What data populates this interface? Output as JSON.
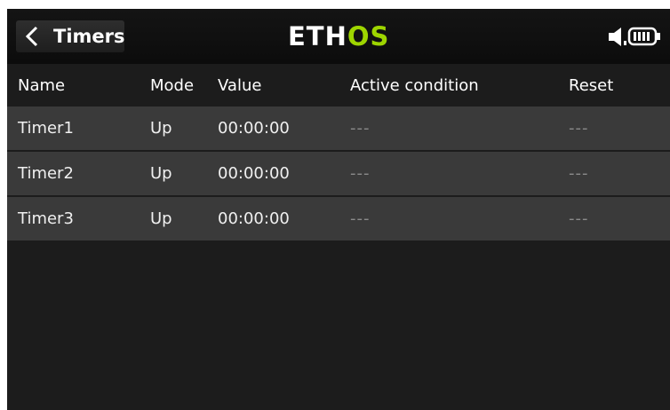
{
  "header": {
    "back_title": "Timers",
    "logo_left": "ETH",
    "logo_right": "OS",
    "status_icons": [
      "speaker-icon",
      "battery-icon"
    ]
  },
  "table": {
    "columns": [
      "Name",
      "Mode",
      "Value",
      "Active condition",
      "Reset"
    ],
    "rows": [
      {
        "name": "Timer1",
        "mode": "Up",
        "value": "00:00:00",
        "condition": "---",
        "reset": "---"
      },
      {
        "name": "Timer2",
        "mode": "Up",
        "value": "00:00:00",
        "condition": "---",
        "reset": "---"
      },
      {
        "name": "Timer3",
        "mode": "Up",
        "value": "00:00:00",
        "condition": "---",
        "reset": "---"
      }
    ]
  },
  "colors": {
    "background": "#1c1c1c",
    "row": "#3b3b3b",
    "brand_accent": "#9ed500",
    "text": "#ffffff"
  }
}
